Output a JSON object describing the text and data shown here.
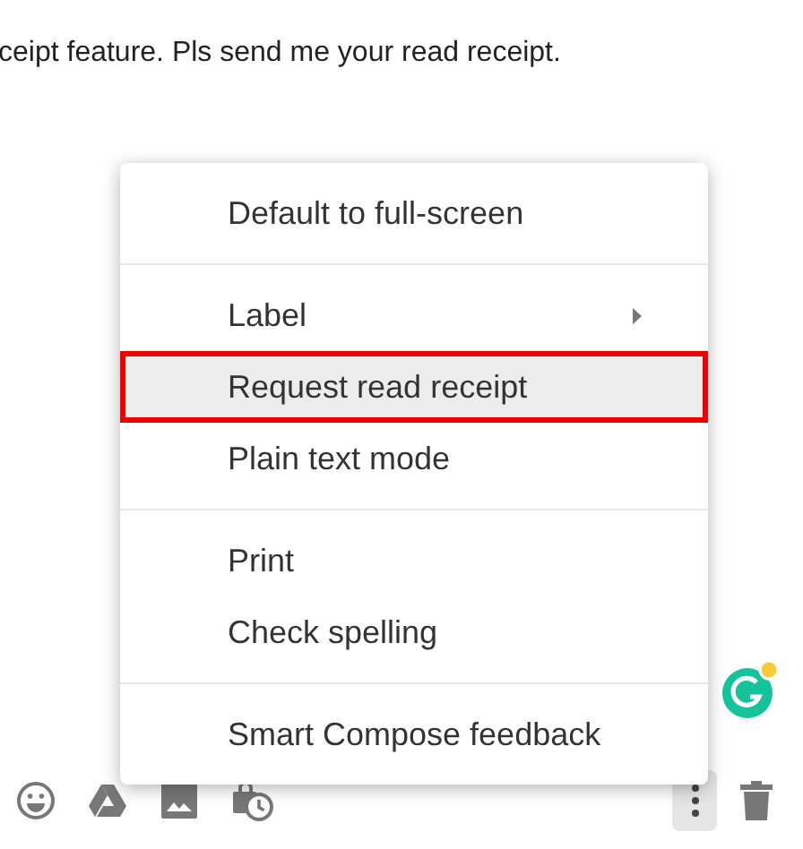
{
  "message": {
    "body": "ceipt feature. Pls send me your read receipt."
  },
  "menu": {
    "sections": [
      [
        {
          "label": "Default to full-screen",
          "selected": false,
          "kind": "item"
        }
      ],
      [
        {
          "label": "Label",
          "selected": false,
          "kind": "submenu"
        },
        {
          "label": "Request read receipt",
          "selected": true,
          "kind": "item"
        },
        {
          "label": "Plain text mode",
          "selected": false,
          "kind": "item"
        }
      ],
      [
        {
          "label": "Print",
          "selected": false,
          "kind": "item"
        },
        {
          "label": "Check spelling",
          "selected": false,
          "kind": "item"
        }
      ],
      [
        {
          "label": "Smart Compose feedback",
          "selected": false,
          "kind": "item"
        }
      ]
    ]
  },
  "toolbar": {
    "more_options_active": true
  }
}
